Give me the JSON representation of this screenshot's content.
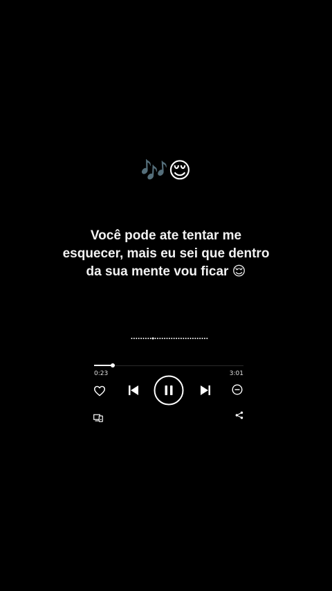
{
  "header": {
    "notes_emoji": "🎶",
    "face_emoji": "😌"
  },
  "lyrics": {
    "line1": "Você pode ate tentar me",
    "line2": "esquecer, mais eu sei que dentro",
    "line3": "da sua mente vou ficar 😌"
  },
  "player": {
    "elapsed": "0:23",
    "total": "3:01",
    "progress_fraction": 0.127,
    "state": "playing"
  },
  "icons": {
    "heart": "heart-icon",
    "previous": "skip-previous-icon",
    "pause": "pause-icon",
    "next": "skip-next-icon",
    "remove": "minus-circle-icon",
    "devices": "connect-devices-icon",
    "share": "share-icon"
  }
}
